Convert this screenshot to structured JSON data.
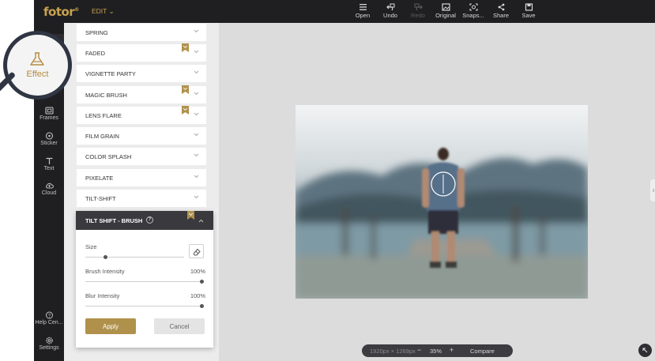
{
  "app": {
    "logo": "fotor",
    "logo_mark": "®",
    "menu_label": "EDIT"
  },
  "toolbar": {
    "items": [
      {
        "label": "Open",
        "icon": "menu-icon"
      },
      {
        "label": "Undo",
        "icon": "undo-icon"
      },
      {
        "label": "Redo",
        "icon": "redo-icon",
        "disabled": true
      },
      {
        "label": "Original",
        "icon": "original-icon"
      },
      {
        "label": "Snaps...",
        "icon": "snapshot-icon"
      },
      {
        "label": "Share",
        "icon": "share-icon"
      },
      {
        "label": "Save",
        "icon": "save-icon"
      }
    ]
  },
  "rail": {
    "items": [
      {
        "label": "Effect",
        "icon": "flask-icon",
        "active": true
      },
      {
        "label": "Frames",
        "icon": "frames-icon"
      },
      {
        "label": "Sticker",
        "icon": "sticker-icon"
      },
      {
        "label": "Text",
        "icon": "text-icon"
      },
      {
        "label": "Cloud",
        "icon": "cloud-icon"
      },
      {
        "label": "Help Cen...",
        "icon": "help-icon"
      },
      {
        "label": "Settings",
        "icon": "settings-icon"
      }
    ]
  },
  "effects": {
    "items": [
      {
        "label": "SPRING",
        "premium": false
      },
      {
        "label": "FADED",
        "premium": true
      },
      {
        "label": "VIGNETTE PARTY",
        "premium": false
      },
      {
        "label": "MAGIC BRUSH",
        "premium": true
      },
      {
        "label": "LENS FLARE",
        "premium": true
      },
      {
        "label": "FILM GRAIN",
        "premium": false
      },
      {
        "label": "COLOR SPLASH",
        "premium": false
      },
      {
        "label": "PIXELATE",
        "premium": false
      },
      {
        "label": "TILT-SHIFT",
        "premium": false
      }
    ],
    "expanded": {
      "title": "TILT SHIFT - BRUSH",
      "help": "?",
      "size_label": "Size",
      "size_value": 0.2,
      "brush_label": "Brush Intensity",
      "brush_value": "100%",
      "blur_label": "Blur Intensity",
      "blur_value": "100%",
      "apply_label": "Apply",
      "cancel_label": "Cancel"
    }
  },
  "status": {
    "dimensions": "1920px × 1269px",
    "zoom_out": "−",
    "zoom": "35%",
    "zoom_in": "+",
    "compare": "Compare"
  },
  "colors": {
    "accent": "#b0914c",
    "dark": "#1f1f22",
    "canvas": "#dcdcdc"
  }
}
